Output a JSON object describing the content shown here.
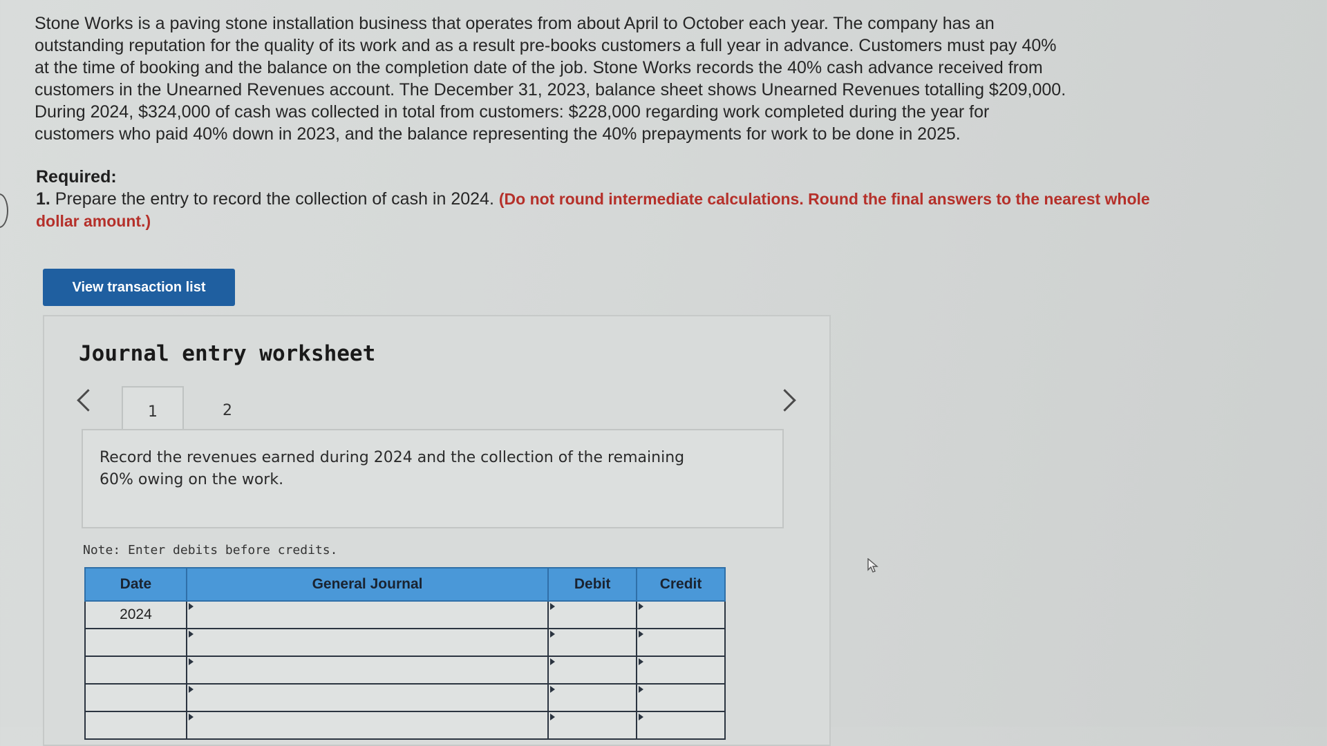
{
  "problem": {
    "lines": [
      "Stone Works is a paving stone installation business that operates from about April to October each year. The company has an",
      "outstanding reputation for the quality of its work and as a result pre-books customers a full year in advance. Customers must pay 40%",
      "at the time of booking and the balance on the completion date of the job. Stone Works records the 40% cash advance received from",
      "customers in the Unearned Revenues account. The December 31, 2023, balance sheet shows Unearned Revenues totalling $209,000.",
      "During 2024, $324,000 of cash was collected in total from customers: $228,000 regarding work completed during the year for",
      "customers who paid 40% down in 2023, and the balance representing the 40% prepayments for work to be done in 2025."
    ]
  },
  "required": {
    "heading": "Required:",
    "number": "1.",
    "text": " Prepare the entry to record the collection of cash in 2024. ",
    "instruction": "(Do not round intermediate calculations. Round the final answers to the nearest whole dollar amount.)"
  },
  "view_button": {
    "label": "View transaction list"
  },
  "worksheet": {
    "title": "Journal entry worksheet",
    "tabs": [
      "1",
      "2"
    ],
    "active_tab": "1",
    "entry_description": "Record the revenues earned during 2024 and the collection of the remaining 60% owing on the work.",
    "note": "Note: Enter debits before credits.",
    "table": {
      "headers": [
        "Date",
        "General Journal",
        "Debit",
        "Credit"
      ],
      "rows": [
        {
          "date": "2024",
          "account": "",
          "debit": "",
          "credit": ""
        },
        {
          "date": "",
          "account": "",
          "debit": "",
          "credit": ""
        },
        {
          "date": "",
          "account": "",
          "debit": "",
          "credit": ""
        },
        {
          "date": "",
          "account": "",
          "debit": "",
          "credit": ""
        },
        {
          "date": "",
          "account": "",
          "debit": "",
          "credit": ""
        }
      ]
    }
  },
  "icons": {
    "prev": "chevron-left-icon",
    "next": "chevron-right-icon",
    "cursor": "mouse-pointer-icon"
  },
  "colors": {
    "button_bg": "#1f5fa0",
    "table_header_bg": "#4a98d8",
    "instruction_red": "#b5302a"
  }
}
